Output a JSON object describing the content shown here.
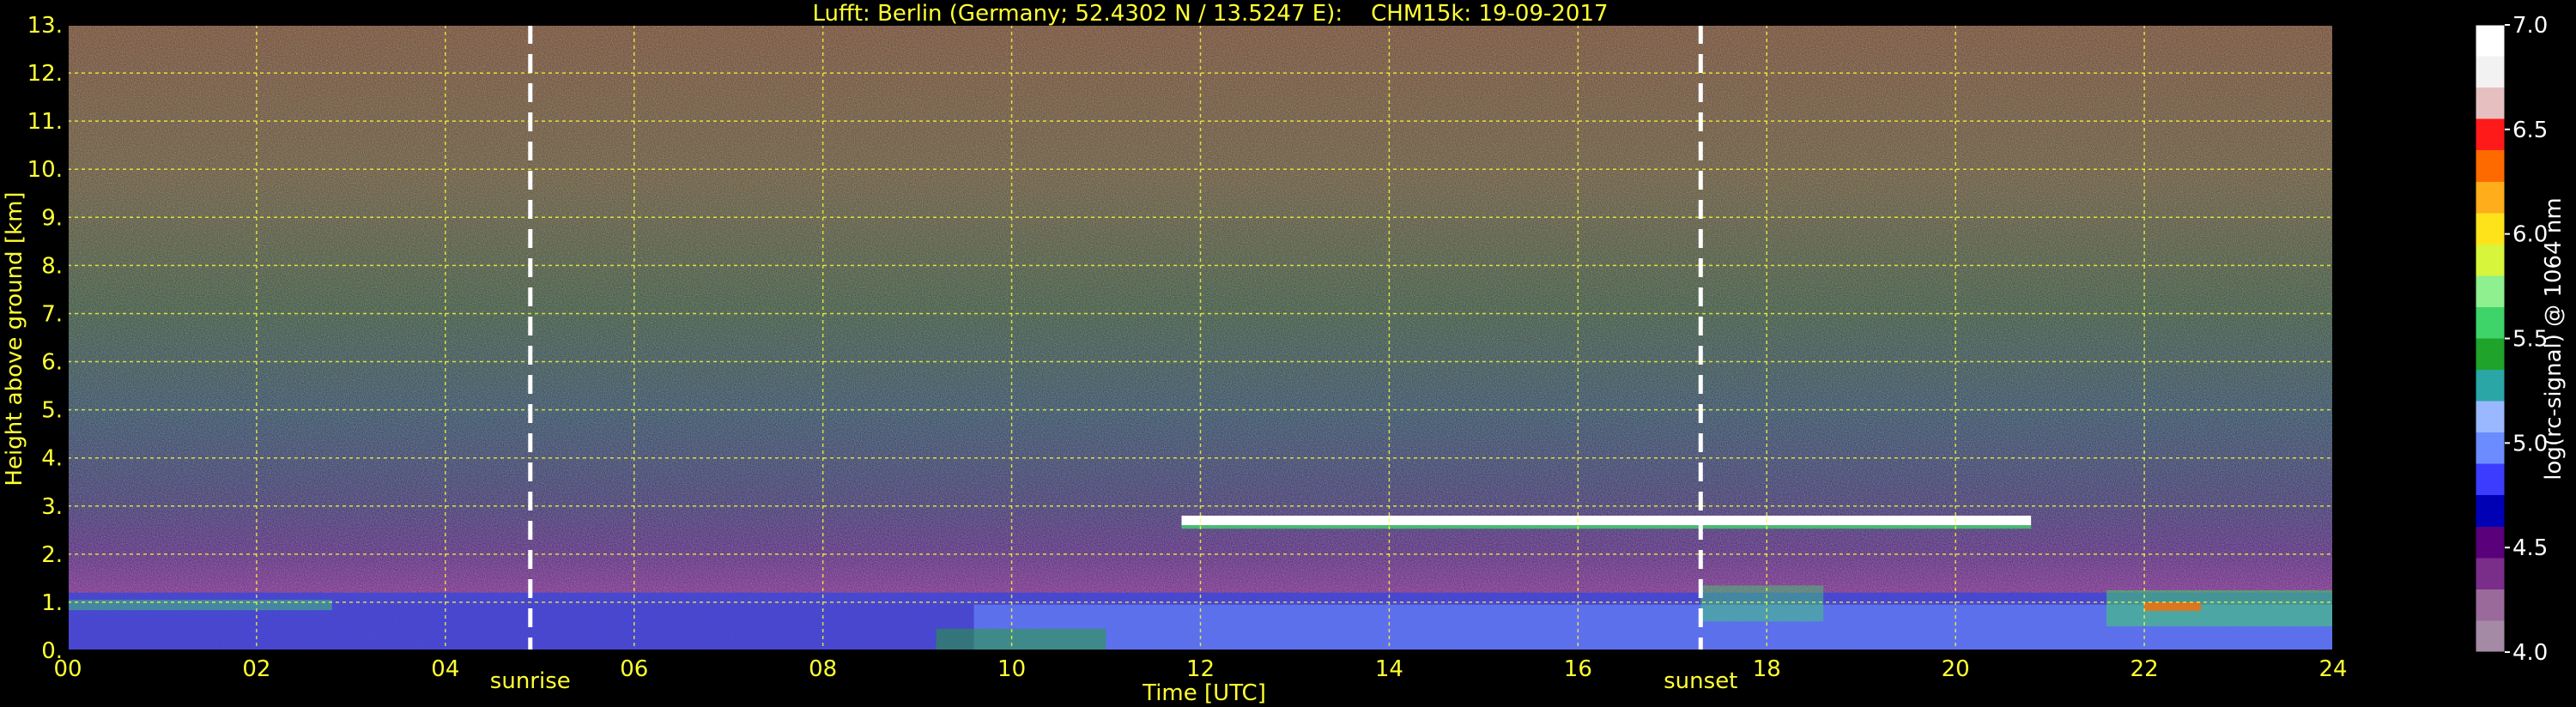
{
  "chart_data": {
    "type": "heatmap",
    "title": "Lufft: Berlin (Germany; 52.4302 N / 13.5247 E):    CHM15k: 19-09-2017",
    "xlabel": "Time [UTC]",
    "ylabel": "Height above ground [km]",
    "xlim": [
      0,
      24
    ],
    "ylim": [
      0,
      13
    ],
    "x_ticks": [
      "00",
      "02",
      "04",
      "06",
      "08",
      "10",
      "12",
      "14",
      "16",
      "18",
      "20",
      "22",
      "24"
    ],
    "y_ticks": [
      "0.",
      "1.",
      "2.",
      "3.",
      "4.",
      "5.",
      "6.",
      "7.",
      "8.",
      "9.",
      "10.",
      "11.",
      "12.",
      "13."
    ],
    "grid": true,
    "annotations": [
      {
        "label": "sunrise",
        "x": 4.9
      },
      {
        "label": "sunset",
        "x": 17.3
      }
    ],
    "colorbar": {
      "label": "log(rc-signal) @ 1064 nm",
      "range": [
        4.0,
        7.0
      ],
      "ticks": [
        "4.0",
        "4.5",
        "5.0",
        "5.5",
        "6.0",
        "6.5",
        "7.0"
      ],
      "colors": [
        "#a58aa5",
        "#9a6a9a",
        "#7a2e8a",
        "#5a007a",
        "#0000b4",
        "#3c3cff",
        "#6b8cff",
        "#9ab8ff",
        "#2aa6a6",
        "#1fa32a",
        "#3fd46a",
        "#8ef08e",
        "#d7f53a",
        "#ffe31a",
        "#ffad1a",
        "#ff6a00",
        "#ff1a1a",
        "#e6c0c0",
        "#f2f2f2",
        "#ffffff"
      ]
    },
    "features": [
      {
        "label": "boundary layer",
        "x_range": [
          0,
          24
        ],
        "height_km": [
          0,
          1.2
        ]
      },
      {
        "label": "cloud layer",
        "x_range": [
          11.8,
          20.8
        ],
        "height_km": [
          2.6,
          2.8
        ]
      }
    ]
  }
}
